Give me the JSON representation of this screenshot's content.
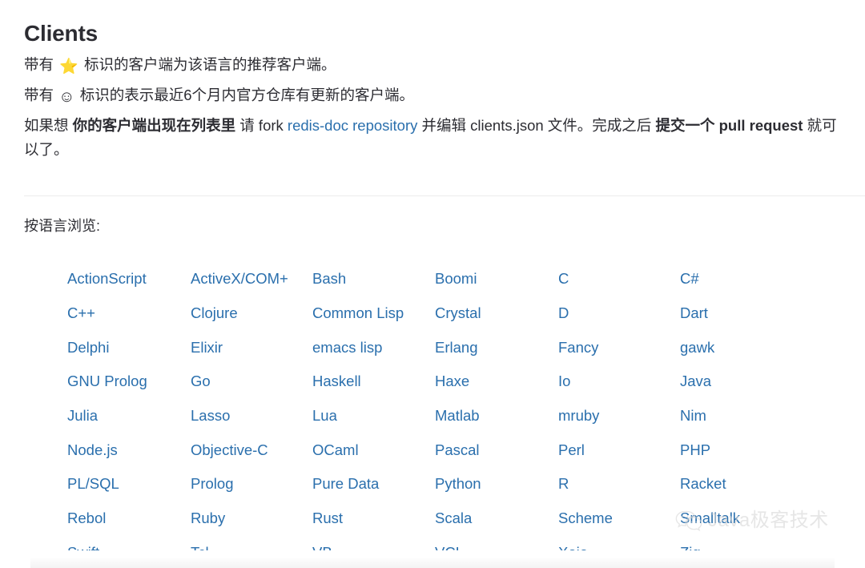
{
  "page": {
    "title": "Clients"
  },
  "intro": {
    "line1": {
      "before": "带有",
      "star_icon": "⭐",
      "after": "标识的客户端为该语言的推荐客户端。"
    },
    "line2": {
      "before": "带有",
      "smile_icon": "☺",
      "after": "标识的表示最近6个月内官方仓库有更新的客户端。"
    },
    "line3": {
      "seg1": "如果想 ",
      "seg2_bold": "你的客户端出现在列表里",
      "seg3": " 请 fork ",
      "link_label": "redis-doc repository",
      "seg4": " 并编辑 clients.json 文件。完成之后 ",
      "seg5_bold": "提交一个 pull request",
      "seg6": " 就可以了。"
    }
  },
  "browse": {
    "label": "按语言浏览:"
  },
  "languages": [
    "ActionScript",
    "ActiveX/COM+",
    "Bash",
    "Boomi",
    "C",
    "C#",
    "C++",
    "Clojure",
    "Common Lisp",
    "Crystal",
    "D",
    "Dart",
    "Delphi",
    "Elixir",
    "emacs lisp",
    "Erlang",
    "Fancy",
    "gawk",
    "GNU Prolog",
    "Go",
    "Haskell",
    "Haxe",
    "Io",
    "Java",
    "Julia",
    "Lasso",
    "Lua",
    "Matlab",
    "mruby",
    "Nim",
    "Node.js",
    "Objective-C",
    "OCaml",
    "Pascal",
    "Perl",
    "PHP",
    "PL/SQL",
    "Prolog",
    "Pure Data",
    "Python",
    "R",
    "Racket",
    "Rebol",
    "Ruby",
    "Rust",
    "Scala",
    "Scheme",
    "Smalltalk",
    "Swift",
    "Tcl",
    "VB",
    "VCL",
    "Xojo",
    "Zig"
  ],
  "watermark": {
    "text": "Java极客技术",
    "icon": "wechat-icon"
  },
  "colors": {
    "link": "#2a6fad",
    "text": "#2c2c32",
    "background": "#ffffff",
    "divider": "#ececec",
    "star": "#f5c518",
    "watermark": "#d8d8d8"
  }
}
